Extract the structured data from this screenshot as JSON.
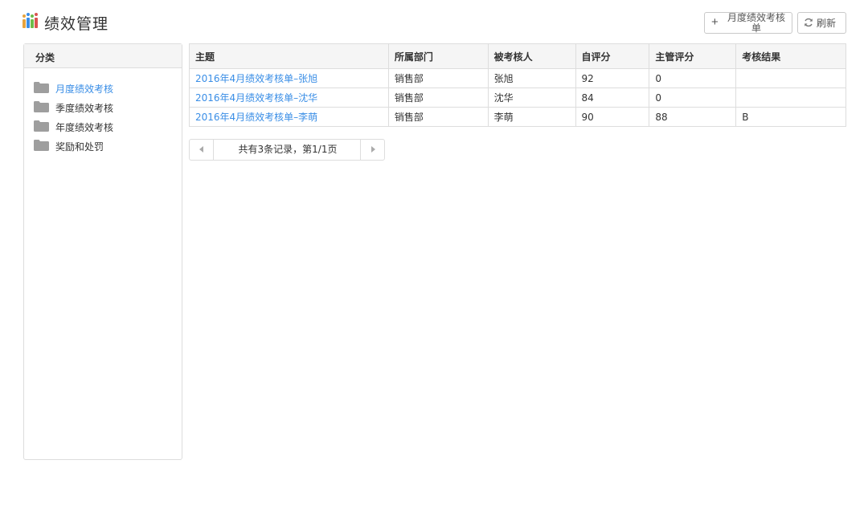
{
  "header": {
    "title": "绩效管理",
    "logo_icon": "bar-chart-people-icon",
    "logo_colors": [
      "#e8a33d",
      "#3a8ee6",
      "#6dbb4a",
      "#d9534f"
    ],
    "add_button_label": "月度绩效考核单",
    "add_icon": "plus-icon",
    "refresh_button_label": "刷新",
    "refresh_icon": "refresh-icon"
  },
  "sidebar": {
    "header": "分类",
    "folder_icon": "folder-icon",
    "items": [
      {
        "label": "月度绩效考核",
        "active": true
      },
      {
        "label": "季度绩效考核",
        "active": false
      },
      {
        "label": "年度绩效考核",
        "active": false
      },
      {
        "label": "奖励和处罚",
        "active": false
      }
    ]
  },
  "table": {
    "columns": [
      "主题",
      "所属部门",
      "被考核人",
      "自评分",
      "主管评分",
      "考核结果"
    ],
    "rows": [
      {
        "subject": "2016年4月绩效考核单–张旭",
        "department": "销售部",
        "assessee": "张旭",
        "self_score": "92",
        "manager_score": "0",
        "result": ""
      },
      {
        "subject": "2016年4月绩效考核单–沈华",
        "department": "销售部",
        "assessee": "沈华",
        "self_score": "84",
        "manager_score": "0",
        "result": ""
      },
      {
        "subject": "2016年4月绩效考核单–李萌",
        "department": "销售部",
        "assessee": "李萌",
        "self_score": "90",
        "manager_score": "88",
        "result": "B"
      }
    ]
  },
  "pager": {
    "info": "共有3条记录，第1/1页",
    "prev_icon": "triangle-left-icon",
    "next_icon": "triangle-right-icon"
  },
  "colors": {
    "link": "#3a8ee6",
    "border": "#dddddd",
    "header_bg": "#f5f5f5",
    "folder": "#9e9e9e"
  }
}
